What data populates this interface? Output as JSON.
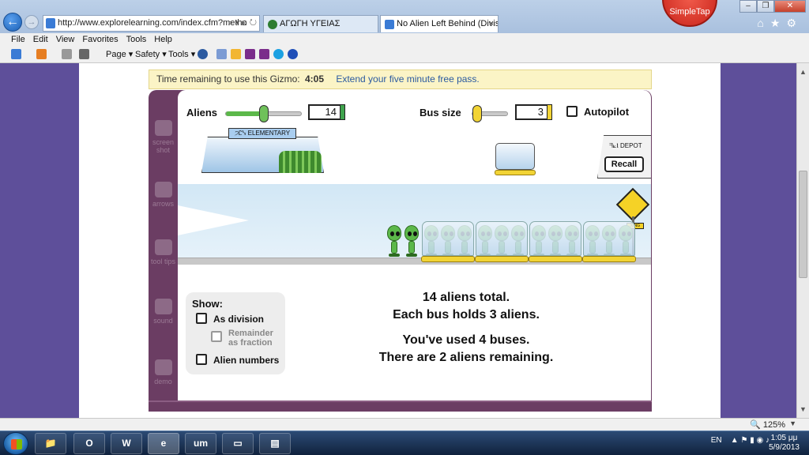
{
  "browser": {
    "address": "http://www.explorelearning.com/index.cfm?metho",
    "tabs": [
      {
        "label": "ΑΓΩΓΗ ΥΓΕΙΑΣ"
      },
      {
        "label": "No Alien Left Behind (Divisi...",
        "close": "×"
      }
    ],
    "simpletap": "SimpleTap",
    "menu": [
      "File",
      "Edit",
      "View",
      "Favorites",
      "Tools",
      "Help"
    ],
    "commands": {
      "page": "Page ▾",
      "safety": "Safety ▾",
      "tools": "Tools ▾"
    },
    "zoom": "125%"
  },
  "gizmo": {
    "time_label": "Time remaining to use this Gizmo:",
    "time_value": "4:05",
    "extend_link": "Extend your five minute free pass.",
    "sidebar": [
      "screen shot",
      "arrows",
      "tool tips",
      "sound",
      "demo"
    ],
    "aliens_label": "Aliens",
    "aliens_value": "14",
    "aliens_slider": 0.5,
    "bus_label": "Bus size",
    "bus_value": "3",
    "bus_slider": 0.0,
    "autopilot_label": "Autopilot",
    "autopilot_checked": false,
    "school_sign": "ELEMENTARY",
    "school_sign_glyph": "੭Ꮭᓭ",
    "depot_label": "DEPOT",
    "depot_glyph": "ᖷ⟀Ⲓ",
    "recall_label": "Recall",
    "show_title": "Show:",
    "show_options": [
      {
        "label": "As division",
        "checked": false,
        "enabled": true
      },
      {
        "label": "Remainder as fraction",
        "checked": false,
        "enabled": false
      },
      {
        "label": "Alien numbers",
        "checked": false,
        "enabled": true
      }
    ],
    "message": {
      "line1": "14 aliens total.",
      "line2": "Each bus holds 3 aliens.",
      "line3": "You've used 4 buses.",
      "line4": "There are 2 aliens remaining."
    },
    "scene": {
      "waiting_aliens": 2,
      "buses": 4,
      "aliens_per_bus": 3
    }
  },
  "taskbar": {
    "lang": "EN",
    "time": "1:05 μμ",
    "date": "5/9/2013"
  }
}
